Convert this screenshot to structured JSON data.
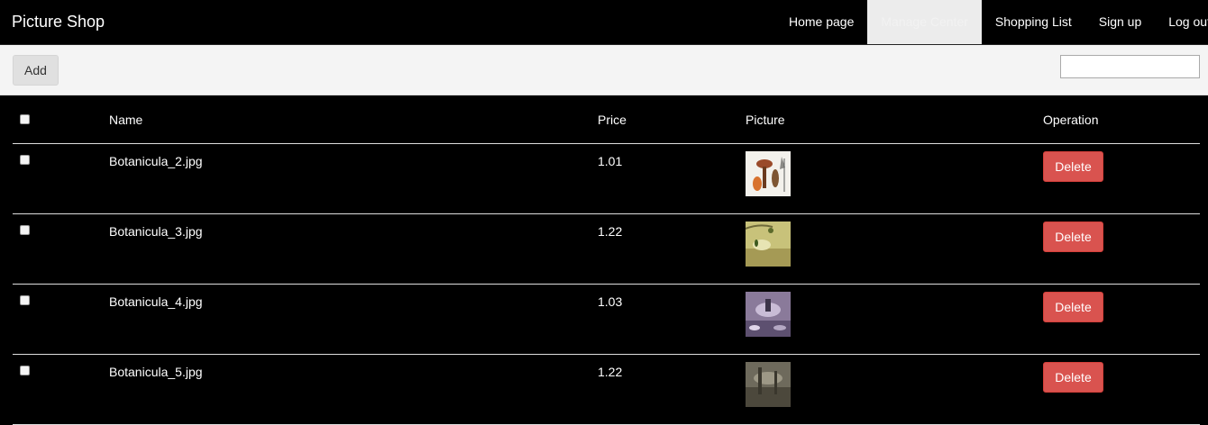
{
  "brand": "Picture Shop",
  "nav": [
    {
      "label": "Home page",
      "active": false
    },
    {
      "label": "Manage Center",
      "active": true
    },
    {
      "label": "Shopping List",
      "active": false
    },
    {
      "label": "Sign up",
      "active": false
    },
    {
      "label": "Log out",
      "active": false
    }
  ],
  "toolbar": {
    "add_label": "Add",
    "search_value": ""
  },
  "table": {
    "headers": {
      "name": "Name",
      "price": "Price",
      "picture": "Picture",
      "operation": "Operation"
    },
    "rows": [
      {
        "name": "Botanicula_2.jpg",
        "price": "1.01",
        "delete_label": "Delete"
      },
      {
        "name": "Botanicula_3.jpg",
        "price": "1.22",
        "delete_label": "Delete"
      },
      {
        "name": "Botanicula_4.jpg",
        "price": "1.03",
        "delete_label": "Delete"
      },
      {
        "name": "Botanicula_5.jpg",
        "price": "1.22",
        "delete_label": "Delete"
      }
    ]
  },
  "colors": {
    "danger": "#d9534f",
    "navbar_bg": "#000000",
    "toolbar_bg": "#f4f4f4"
  }
}
